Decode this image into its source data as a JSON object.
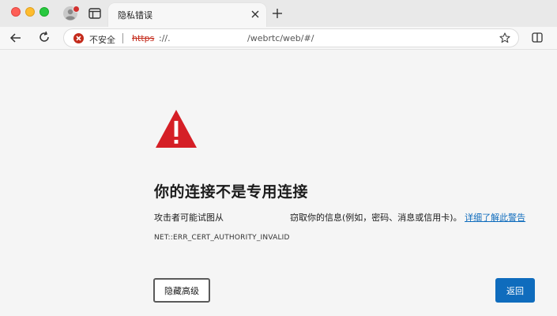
{
  "tab": {
    "title": "隐私错误"
  },
  "address_bar": {
    "security_label": "不安全",
    "url_scheme": "https",
    "url_host": "://.",
    "url_path": "/webrtc/web/#/"
  },
  "error_page": {
    "heading": "你的连接不是专用连接",
    "description_prefix": "攻击者可能试图从",
    "description_suffix": "窃取你的信息(例如，密码、消息或信用卡)。",
    "learn_more_link": "详细了解此警告",
    "error_code": "NET::ERR_CERT_AUTHORITY_INVALID",
    "advanced_button": "隐藏高级",
    "back_button": "返回"
  },
  "colors": {
    "accent": "#0f6cbd",
    "danger": "#c42b1c",
    "warning_triangle": "#d51f26"
  },
  "icons": {
    "profile": "profile-icon",
    "tabs": "vertical-tabs-icon",
    "close": "close-icon",
    "new_tab": "plus-icon",
    "back": "back-arrow-icon",
    "reload": "reload-icon",
    "security": "not-secure-icon",
    "favorite": "star-icon",
    "split": "split-screen-icon",
    "warning": "warning-triangle-icon"
  }
}
